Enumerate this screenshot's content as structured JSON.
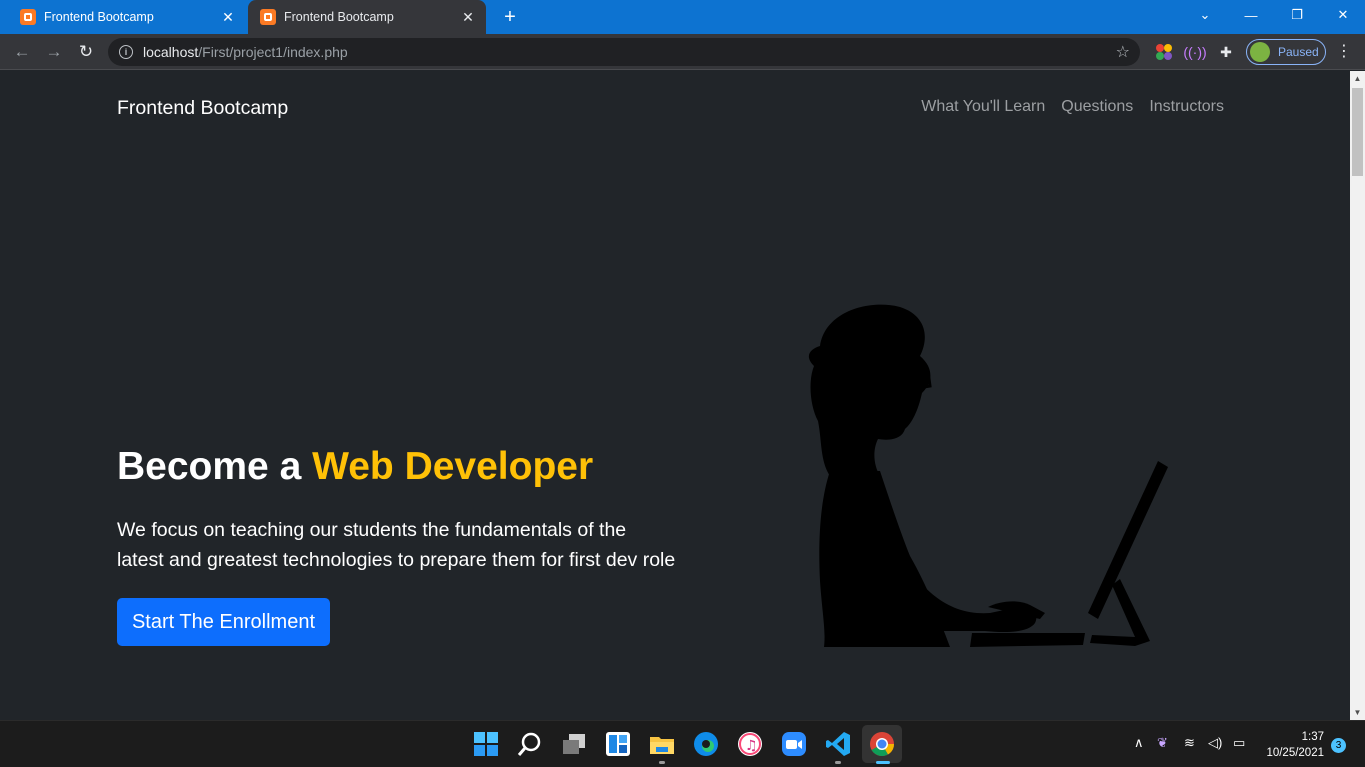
{
  "browser": {
    "tabs": [
      {
        "title": "Frontend Bootcamp",
        "active": false
      },
      {
        "title": "Frontend Bootcamp",
        "active": true
      }
    ],
    "url_host": "localhost",
    "url_path": "/First/project1/index.php",
    "profile_status": "Paused"
  },
  "page": {
    "brand": "Frontend Bootcamp",
    "nav_links": [
      "What You'll Learn",
      "Questions",
      "Instructors"
    ],
    "hero": {
      "title_prefix": "Become a ",
      "title_accent": "Web Developer",
      "lead": "We focus on teaching our students the fundamentals of the latest and greatest technologies to prepare them for first dev role",
      "cta_label": "Start The Enrollment"
    },
    "colors": {
      "background": "#212529",
      "accent": "#ffc107",
      "primary": "#0d6efd"
    }
  },
  "taskbar": {
    "apps": [
      "start-icon",
      "search-icon",
      "task-view-icon",
      "widgets-icon",
      "file-explorer-icon",
      "edge-icon",
      "itunes-icon",
      "zoom-icon",
      "vscode-icon",
      "chrome-icon"
    ],
    "time": "1:37",
    "date": "10/25/2021",
    "notifications": "3"
  }
}
